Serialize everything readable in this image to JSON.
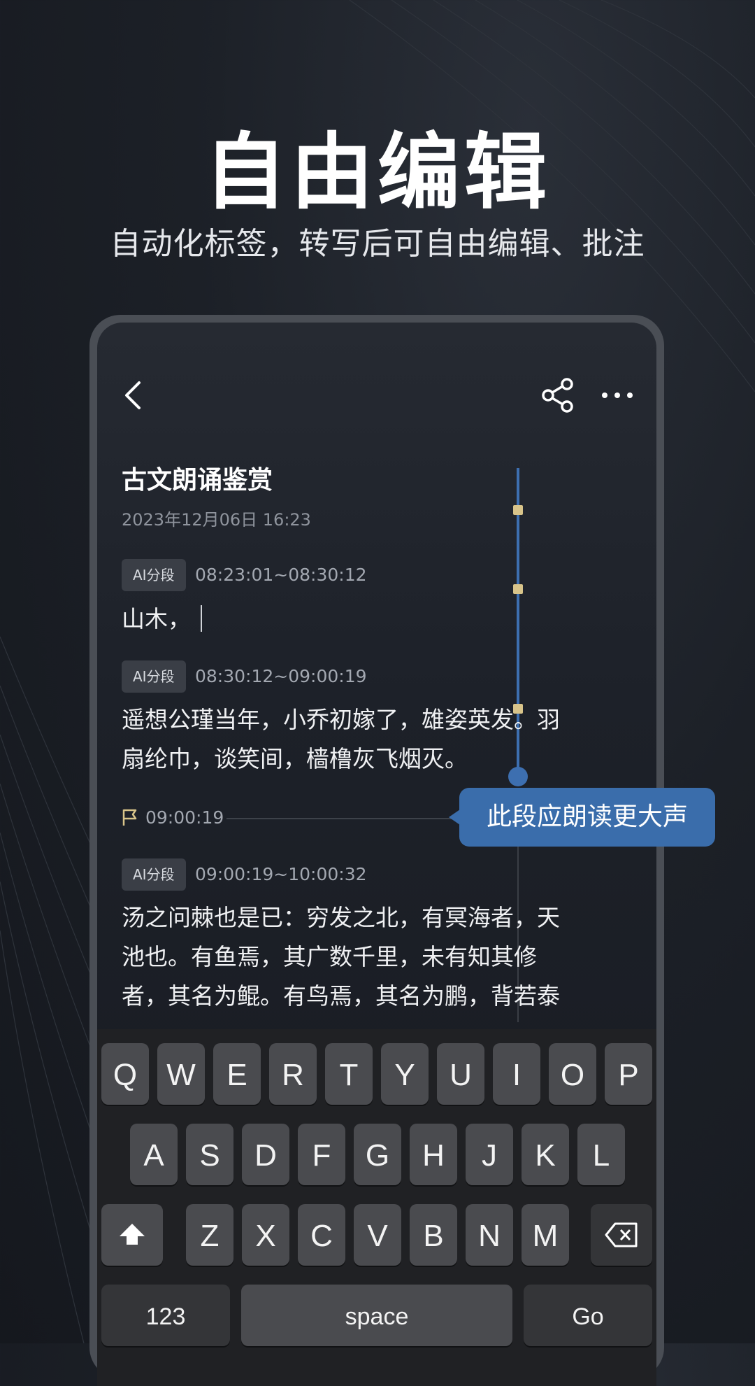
{
  "header": {
    "title": "自由编辑",
    "subtitle": "自动化标签，转写后可自由编辑、批注"
  },
  "doc": {
    "title": "古文朗诵鉴赏",
    "date": "2023年12月06日 16:23",
    "segments": [
      {
        "tag": "AI分段",
        "time": "08:23:01~08:30:12",
        "text": "山木，"
      },
      {
        "tag": "AI分段",
        "time": "08:30:12~09:00:19",
        "text": "遥想公瑾当年，小乔初嫁了，雄姿英发。羽扇纶巾，谈笑间，樯橹灰飞烟灭。"
      },
      {
        "tag": "AI分段",
        "time": "09:00:19~10:00:32",
        "text": "汤之问棘也是已：穷发之北，有冥海者，天池也。有鱼焉，其广数千里，未有知其修者，其名为鲲。有鸟焉，其名为鹏，背若泰"
      }
    ],
    "flag_time": "09:00:19",
    "annotation": "此段应朗读更大声"
  },
  "keyboard": {
    "row1": [
      "Q",
      "W",
      "E",
      "R",
      "T",
      "Y",
      "U",
      "I",
      "O",
      "P"
    ],
    "row2": [
      "A",
      "S",
      "D",
      "F",
      "G",
      "H",
      "J",
      "K",
      "L"
    ],
    "row3": [
      "Z",
      "X",
      "C",
      "V",
      "B",
      "N",
      "M"
    ],
    "numbers_label": "123",
    "space_label": "space",
    "go_label": "Go"
  },
  "colors": {
    "accent": "#3a6dab",
    "marker": "#d8c48a",
    "background": "#1c2027"
  }
}
